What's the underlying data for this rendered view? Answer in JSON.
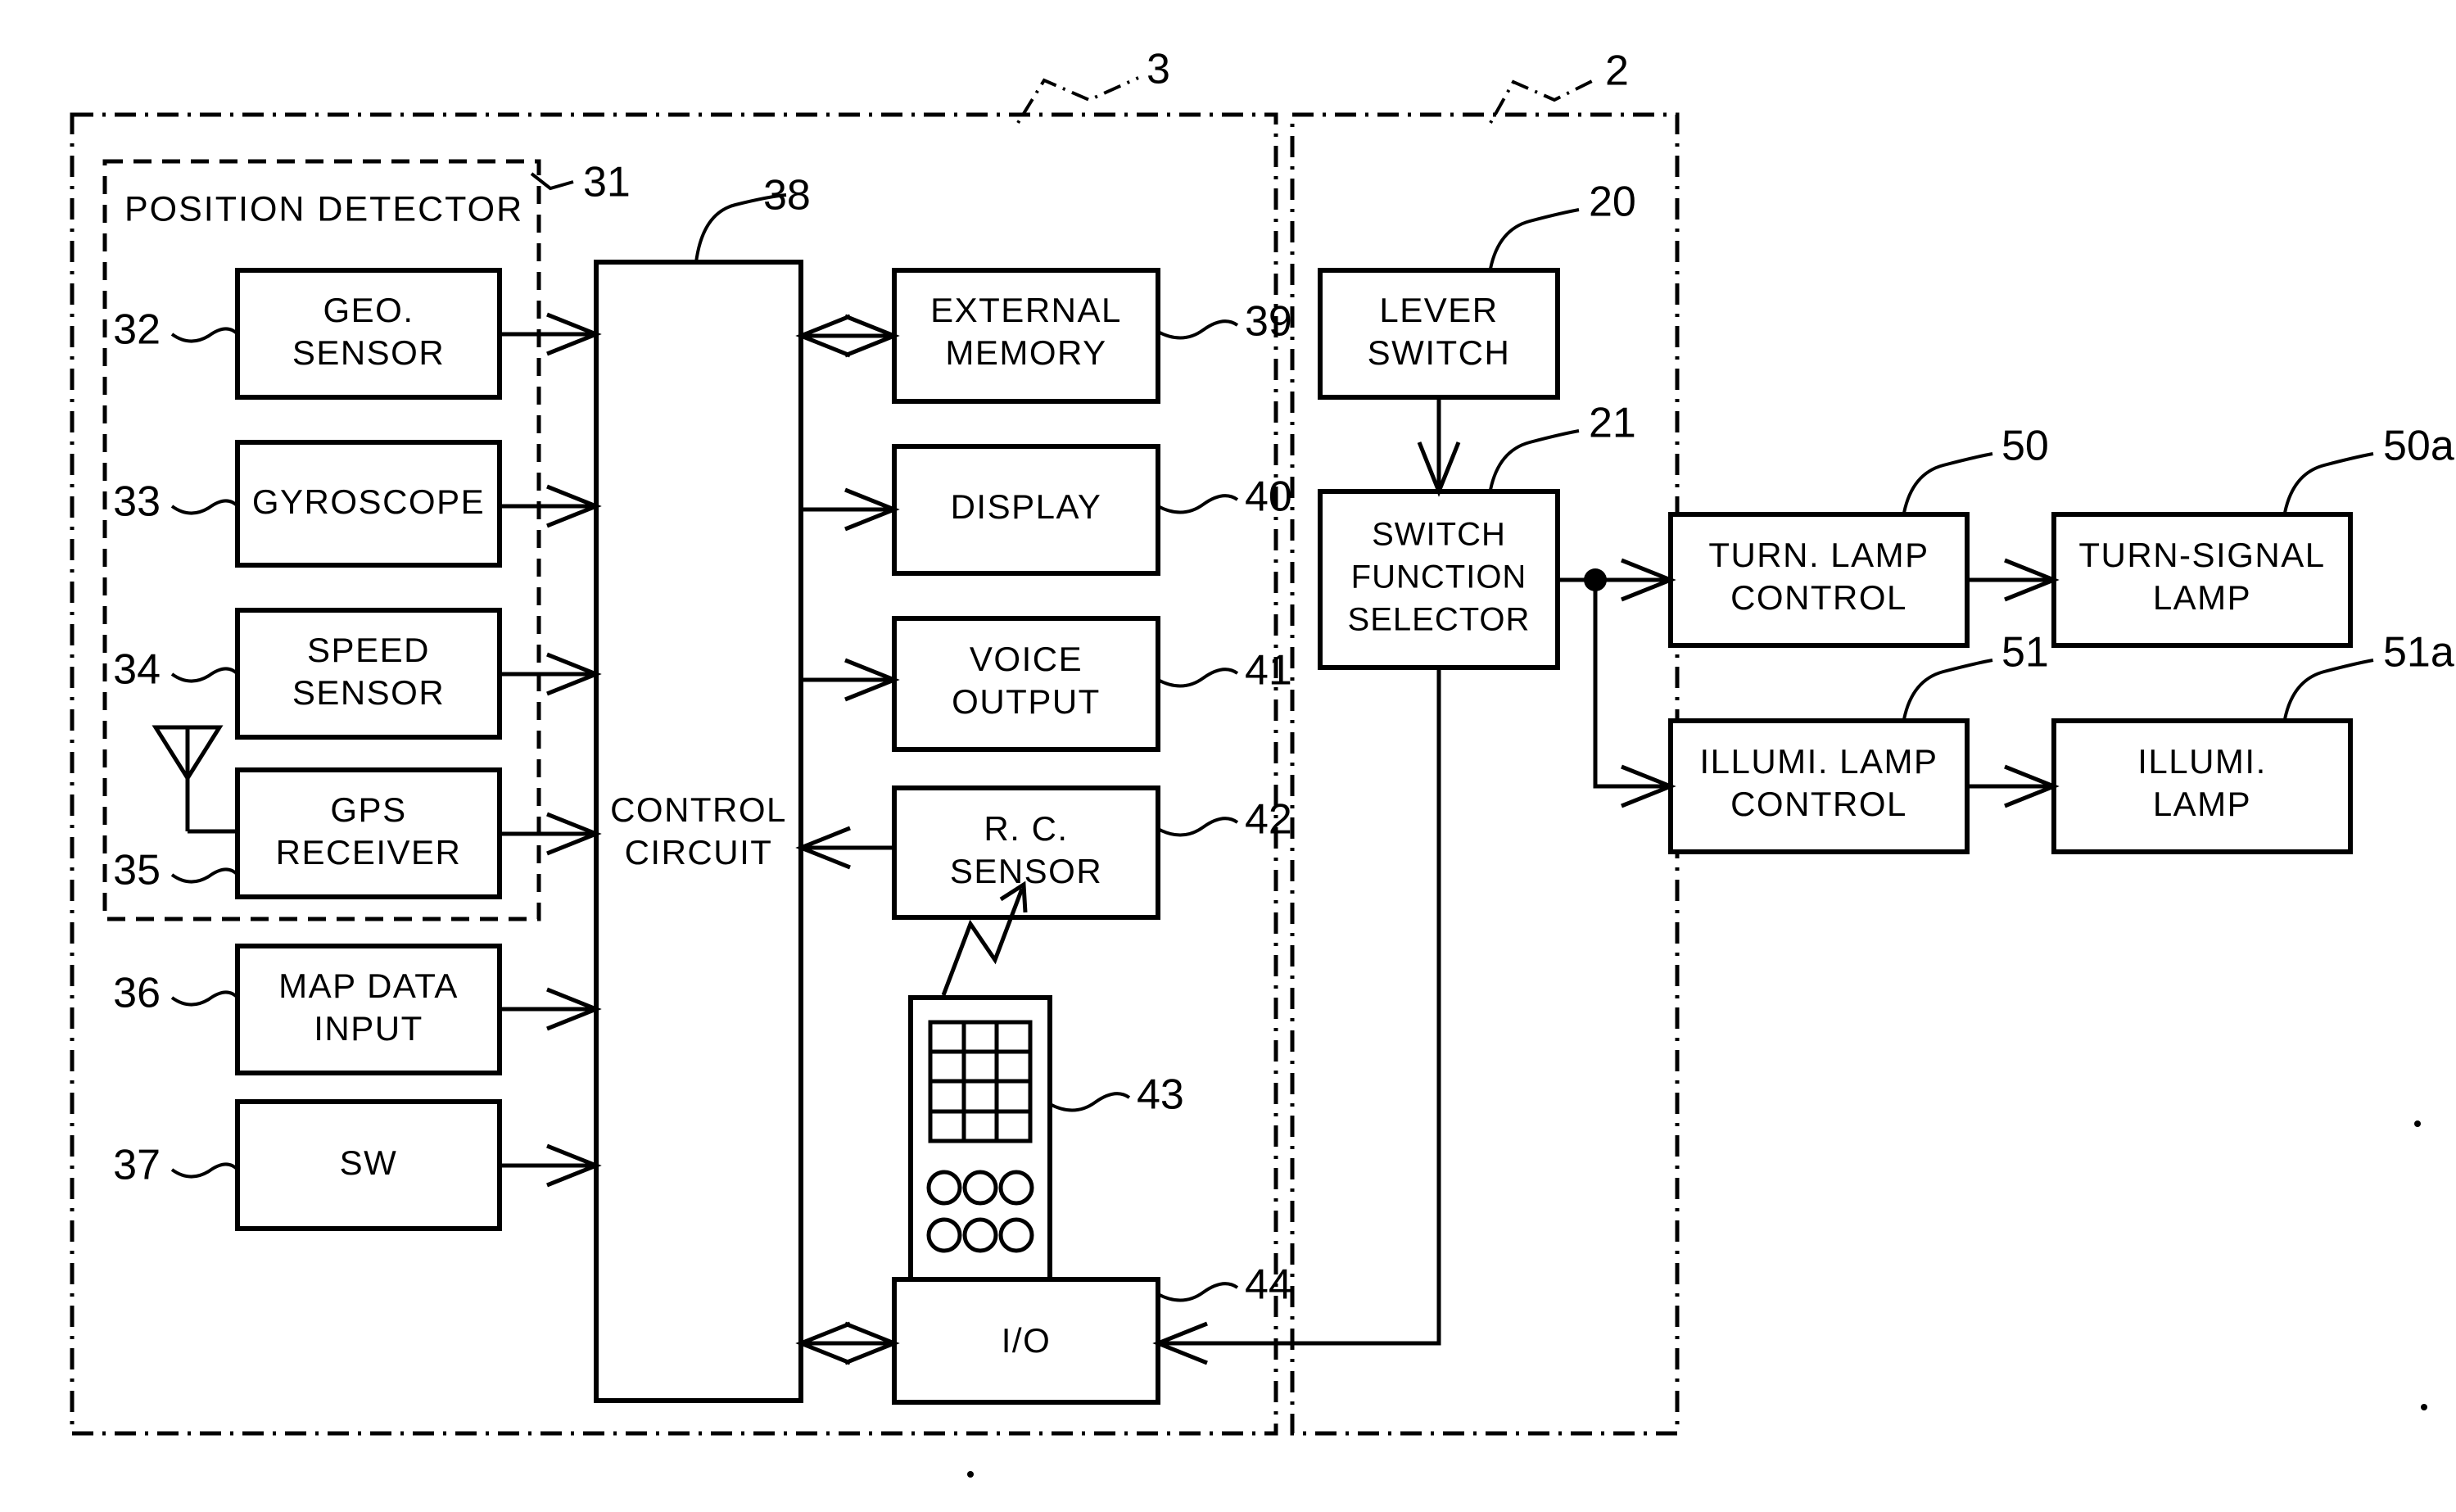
{
  "figure": {
    "title": "Vehicle navigation and lamp control block diagram",
    "stroke_color": "#000000",
    "background_color": "#ffffff"
  },
  "groups": [
    {
      "id": "nav-unit",
      "ref": "3",
      "style": "dash-dot"
    },
    {
      "id": "switch-unit",
      "ref": "2",
      "style": "dash-dot"
    },
    {
      "id": "position-detector",
      "ref": "31",
      "label": "POSITION DETECTOR",
      "style": "dashed"
    }
  ],
  "blocks": [
    {
      "id": "geo-sensor",
      "ref": "32",
      "lines": [
        "GEO.",
        "SENSOR"
      ]
    },
    {
      "id": "gyroscope",
      "ref": "33",
      "lines": [
        "GYROSCOPE"
      ]
    },
    {
      "id": "speed-sensor",
      "ref": "34",
      "lines": [
        "SPEED",
        "SENSOR"
      ]
    },
    {
      "id": "gps-receiver",
      "ref": "35",
      "lines": [
        "GPS",
        "RECEIVER"
      ]
    },
    {
      "id": "map-data-input",
      "ref": "36",
      "lines": [
        "MAP DATA",
        "INPUT"
      ]
    },
    {
      "id": "sw",
      "ref": "37",
      "lines": [
        "SW"
      ]
    },
    {
      "id": "control-circuit",
      "ref": "38",
      "lines": [
        "CONTROL",
        "CIRCUIT"
      ]
    },
    {
      "id": "external-memory",
      "ref": "39",
      "lines": [
        "EXTERNAL",
        "MEMORY"
      ]
    },
    {
      "id": "display",
      "ref": "40",
      "lines": [
        "DISPLAY"
      ]
    },
    {
      "id": "voice-output",
      "ref": "41",
      "lines": [
        "VOICE",
        "OUTPUT"
      ]
    },
    {
      "id": "rc-sensor",
      "ref": "42",
      "lines": [
        "R. C.",
        "SENSOR"
      ]
    },
    {
      "id": "remote-control",
      "ref": "43",
      "lines": []
    },
    {
      "id": "io",
      "ref": "44",
      "lines": [
        "I/O"
      ]
    },
    {
      "id": "lever-switch",
      "ref": "20",
      "lines": [
        "LEVER",
        "SWITCH"
      ]
    },
    {
      "id": "switch-function-selector",
      "ref": "21",
      "lines": [
        "SWITCH",
        "FUNCTION",
        "SELECTOR"
      ]
    },
    {
      "id": "turn-lamp-control",
      "ref": "50",
      "lines": [
        "TURN.  LAMP",
        "CONTROL"
      ]
    },
    {
      "id": "turn-signal-lamp",
      "ref": "50a",
      "lines": [
        "TURN-SIGNAL",
        "LAMP"
      ]
    },
    {
      "id": "illumi-lamp-control",
      "ref": "51",
      "lines": [
        "ILLUMI. LAMP",
        "CONTROL"
      ]
    },
    {
      "id": "illumi-lamp",
      "ref": "51a",
      "lines": [
        "ILLUMI.",
        "LAMP"
      ]
    }
  ],
  "reference_numerals": [
    "2",
    "3",
    "20",
    "21",
    "31",
    "32",
    "33",
    "34",
    "35",
    "36",
    "37",
    "38",
    "39",
    "40",
    "41",
    "42",
    "43",
    "44",
    "50",
    "50a",
    "51",
    "51a"
  ],
  "connections": [
    {
      "from": "geo-sensor",
      "to": "control-circuit",
      "arrow": "single"
    },
    {
      "from": "gyroscope",
      "to": "control-circuit",
      "arrow": "single"
    },
    {
      "from": "speed-sensor",
      "to": "control-circuit",
      "arrow": "single"
    },
    {
      "from": "gps-receiver",
      "to": "control-circuit",
      "arrow": "single"
    },
    {
      "from": "map-data-input",
      "to": "control-circuit",
      "arrow": "single"
    },
    {
      "from": "sw",
      "to": "control-circuit",
      "arrow": "single"
    },
    {
      "from": "control-circuit",
      "to": "external-memory",
      "arrow": "double"
    },
    {
      "from": "control-circuit",
      "to": "display",
      "arrow": "single"
    },
    {
      "from": "control-circuit",
      "to": "voice-output",
      "arrow": "single"
    },
    {
      "from": "rc-sensor",
      "to": "control-circuit",
      "arrow": "single"
    },
    {
      "from": "remote-control",
      "to": "rc-sensor",
      "arrow": "wireless"
    },
    {
      "from": "control-circuit",
      "to": "io",
      "arrow": "double"
    },
    {
      "from": "lever-switch",
      "to": "switch-function-selector",
      "arrow": "single"
    },
    {
      "from": "switch-function-selector",
      "to": "turn-lamp-control",
      "arrow": "single"
    },
    {
      "from": "switch-function-selector",
      "to": "illumi-lamp-control",
      "arrow": "single"
    },
    {
      "from": "switch-function-selector",
      "to": "io",
      "arrow": "single"
    },
    {
      "from": "turn-lamp-control",
      "to": "turn-signal-lamp",
      "arrow": "single"
    },
    {
      "from": "illumi-lamp-control",
      "to": "illumi-lamp",
      "arrow": "single"
    },
    {
      "from": "antenna",
      "to": "gps-receiver",
      "arrow": "none"
    }
  ],
  "icons": {
    "antenna": "antenna-icon",
    "remote": "remote-control-icon",
    "wireless": "wireless-signal-icon"
  }
}
